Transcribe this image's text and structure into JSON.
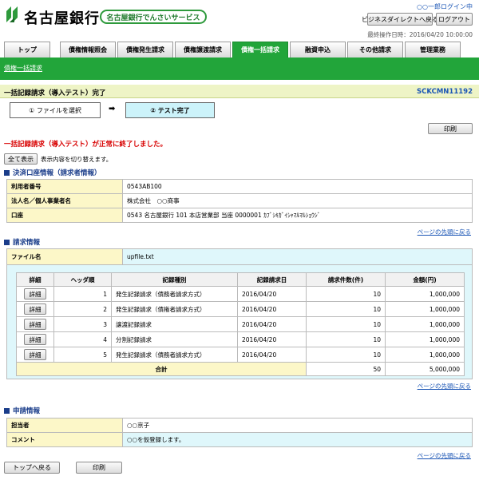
{
  "header": {
    "bank_name": "名古屋銀行",
    "service_name": "名古屋銀行でんさいサービス",
    "user_line": "○○一郎ログイン中",
    "btn_direct": "ビジネスダイレクトへ戻る",
    "btn_logout": "ログアウト",
    "last_operation": "最終操作日時：2016/04/20 10:00:00"
  },
  "tabs": [
    {
      "label": "トップ"
    },
    {
      "label": "債権情報照会"
    },
    {
      "label": "債権発生請求"
    },
    {
      "label": "債権譲渡請求"
    },
    {
      "label": "債権一括請求"
    },
    {
      "label": "融資申込"
    },
    {
      "label": "その他請求"
    },
    {
      "label": "管理業務"
    }
  ],
  "sub_nav": {
    "link": "債権一括請求"
  },
  "page": {
    "title": "一括記録請求（導入テスト）完了",
    "screen_id": "SCKCMN11192"
  },
  "steps": {
    "step1": "① ファイルを選択",
    "step2": "② テスト完了"
  },
  "print_label": "印刷",
  "message": "一括記録請求（導入テスト）が正常に終了しました。",
  "toggle": {
    "button": "全て表示",
    "caption": "表示内容を切り替えます。"
  },
  "settlement": {
    "heading": "決済口座情報（請求者情報）",
    "rows": [
      {
        "label": "利用者番号",
        "value": "0543AB100"
      },
      {
        "label": "法人名／個人事業者名",
        "value": "株式会社　○○商事"
      },
      {
        "label": "口座",
        "value": "0543 名古屋銀行 101 本店営業部 当座 0000001 ｶﾌﾞｼｷｶﾞｲｼｬﾏﾙﾏﾙｼｮｳｼﾞ"
      }
    ]
  },
  "back_to_top": "ページの先頭に戻る",
  "request": {
    "heading": "請求情報",
    "file_label": "ファイル名",
    "file_value": "upfile.txt",
    "columns": [
      "詳細",
      "ヘッダ順",
      "記録種別",
      "記録請求日",
      "請求件数(件)",
      "金額(円)"
    ],
    "detail_btn": "詳細",
    "rows": [
      {
        "order": "1",
        "type": "発生記録請求（債務者請求方式）",
        "date": "2016/04/20",
        "count": "10",
        "amount": "1,000,000"
      },
      {
        "order": "2",
        "type": "発生記録請求（債権者請求方式）",
        "date": "2016/04/20",
        "count": "10",
        "amount": "1,000,000"
      },
      {
        "order": "3",
        "type": "譲渡記録請求",
        "date": "2016/04/20",
        "count": "10",
        "amount": "1,000,000"
      },
      {
        "order": "4",
        "type": "分割記録請求",
        "date": "2016/04/20",
        "count": "10",
        "amount": "1,000,000"
      },
      {
        "order": "5",
        "type": "発生記録請求（債務者請求方式）",
        "date": "2016/04/20",
        "count": "10",
        "amount": "1,000,000"
      }
    ],
    "total_label": "合計",
    "total_count": "50",
    "total_amount": "5,000,000"
  },
  "application": {
    "heading": "申請情報",
    "rows": [
      {
        "label": "担当者",
        "value": "○○京子"
      },
      {
        "label": "コメント",
        "value": "○○を仮登録します。"
      }
    ]
  },
  "footer": {
    "btn_top": "トップへ戻る",
    "btn_print": "印刷"
  },
  "colors": {
    "accent": "#22a53a",
    "link": "#1a55b5",
    "label_bg": "#fcf7c8",
    "cyan_bg": "#dff7fb",
    "error": "#d80000"
  }
}
